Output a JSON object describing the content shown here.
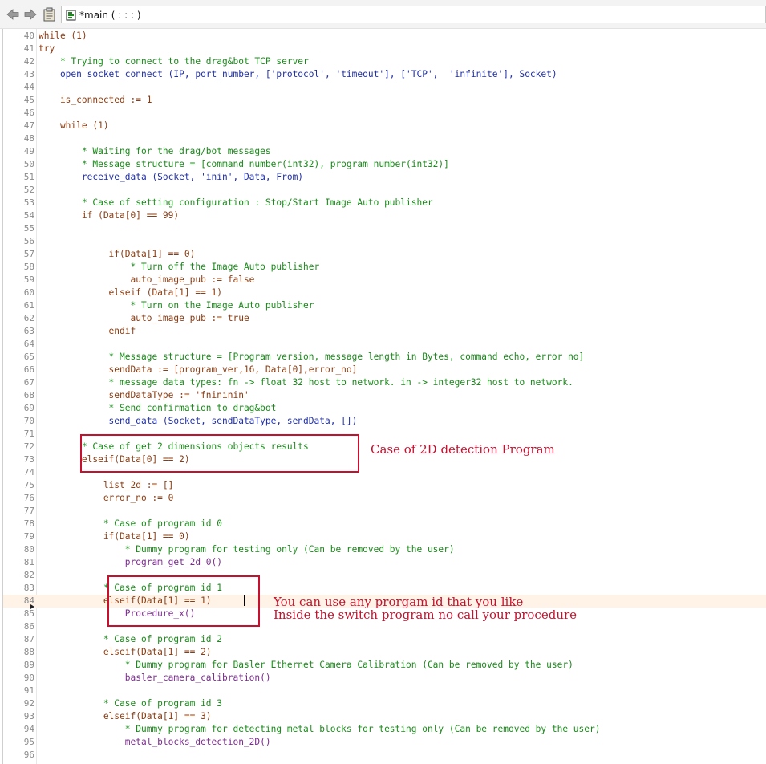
{
  "toolbar": {
    "back_icon": "left-arrow-icon",
    "forward_icon": "right-arrow-icon",
    "clipboard_icon": "clipboard-icon"
  },
  "tab": {
    "icon": "procedure-icon",
    "title": "*main ( : : : )"
  },
  "editor": {
    "current_line": 84,
    "lines": [
      {
        "n": "40",
        "t": "while (1)",
        "c": "kw"
      },
      {
        "n": "41",
        "t": "try",
        "c": "kw"
      },
      {
        "n": "42",
        "t": "    * Trying to connect to the drag&bot TCP server",
        "c": "cm"
      },
      {
        "n": "43",
        "t": "    open_socket_connect (IP, port_number, ['protocol', 'timeout'], ['TCP',  'infinite'], Socket)",
        "c": "fn"
      },
      {
        "n": "44",
        "t": "",
        "c": ""
      },
      {
        "n": "45",
        "t": "    is_connected := 1",
        "c": "kw"
      },
      {
        "n": "46",
        "t": "",
        "c": ""
      },
      {
        "n": "47",
        "t": "    while (1)",
        "c": "kw"
      },
      {
        "n": "48",
        "t": "",
        "c": ""
      },
      {
        "n": "49",
        "t": "        * Waiting for the drag/bot messages",
        "c": "cm"
      },
      {
        "n": "50",
        "t": "        * Message structure = [command number(int32), program number(int32)]",
        "c": "cm"
      },
      {
        "n": "51",
        "t": "        receive_data (Socket, 'inin', Data, From)",
        "c": "fn"
      },
      {
        "n": "52",
        "t": "",
        "c": ""
      },
      {
        "n": "53",
        "t": "        * Case of setting configuration : Stop/Start Image Auto publisher",
        "c": "cm"
      },
      {
        "n": "54",
        "t": "        if (Data[0] == 99)",
        "c": "kw"
      },
      {
        "n": "55",
        "t": "",
        "c": ""
      },
      {
        "n": "56",
        "t": "",
        "c": ""
      },
      {
        "n": "57",
        "t": "             if(Data[1] == 0)",
        "c": "kw"
      },
      {
        "n": "58",
        "t": "                 * Turn off the Image Auto publisher",
        "c": "cm"
      },
      {
        "n": "59",
        "t": "                 auto_image_pub := false",
        "c": "kw"
      },
      {
        "n": "60",
        "t": "             elseif (Data[1] == 1)",
        "c": "kw"
      },
      {
        "n": "61",
        "t": "                 * Turn on the Image Auto publisher",
        "c": "cm"
      },
      {
        "n": "62",
        "t": "                 auto_image_pub := true",
        "c": "kw"
      },
      {
        "n": "63",
        "t": "             endif",
        "c": "kw"
      },
      {
        "n": "64",
        "t": "",
        "c": ""
      },
      {
        "n": "65",
        "t": "             * Message structure = [Program version, message length in Bytes, command echo, error no]",
        "c": "cm"
      },
      {
        "n": "66",
        "t": "             sendData := [program_ver,16, Data[0],error_no]",
        "c": "kw"
      },
      {
        "n": "67",
        "t": "             * message data types: fn -> float 32 host to network. in -> integer32 host to network.",
        "c": "cm"
      },
      {
        "n": "68",
        "t": "             sendDataType := 'fnininin'",
        "c": "kw"
      },
      {
        "n": "69",
        "t": "             * Send confirmation to drag&bot",
        "c": "cm"
      },
      {
        "n": "70",
        "t": "             send_data (Socket, sendDataType, sendData, [])",
        "c": "fn"
      },
      {
        "n": "71",
        "t": "",
        "c": ""
      },
      {
        "n": "72",
        "t": "        * Case of get 2 dimensions objects results",
        "c": "cm"
      },
      {
        "n": "73",
        "t": "        elseif(Data[0] == 2)",
        "c": "kw"
      },
      {
        "n": "74",
        "t": "",
        "c": ""
      },
      {
        "n": "75",
        "t": "            list_2d := []",
        "c": "kw"
      },
      {
        "n": "76",
        "t": "            error_no := 0",
        "c": "kw"
      },
      {
        "n": "77",
        "t": "",
        "c": ""
      },
      {
        "n": "78",
        "t": "            * Case of program id 0",
        "c": "cm"
      },
      {
        "n": "79",
        "t": "            if(Data[1] == 0)",
        "c": "kw"
      },
      {
        "n": "80",
        "t": "                * Dummy program for testing only (Can be removed by the user)",
        "c": "cm"
      },
      {
        "n": "81",
        "t": "                program_get_2d_0()",
        "c": "pr"
      },
      {
        "n": "82",
        "t": "",
        "c": ""
      },
      {
        "n": "83",
        "t": "            * Case of program id 1",
        "c": "cm"
      },
      {
        "n": "84",
        "t": "            elseif(Data[1] == 1)",
        "c": "kw"
      },
      {
        "n": "85",
        "t": "                Procedure_x()",
        "c": "pr"
      },
      {
        "n": "86",
        "t": "",
        "c": ""
      },
      {
        "n": "87",
        "t": "            * Case of program id 2",
        "c": "cm"
      },
      {
        "n": "88",
        "t": "            elseif(Data[1] == 2)",
        "c": "kw"
      },
      {
        "n": "89",
        "t": "                * Dummy program for Basler Ethernet Camera Calibration (Can be removed by the user)",
        "c": "cm"
      },
      {
        "n": "90",
        "t": "                basler_camera_calibration()",
        "c": "pr"
      },
      {
        "n": "91",
        "t": "",
        "c": ""
      },
      {
        "n": "92",
        "t": "            * Case of program id 3",
        "c": "cm"
      },
      {
        "n": "93",
        "t": "            elseif(Data[1] == 3)",
        "c": "kw"
      },
      {
        "n": "94",
        "t": "                * Dummy program for detecting metal blocks for testing only (Can be removed by the user)",
        "c": "cm"
      },
      {
        "n": "95",
        "t": "                metal_blocks_detection_2D()",
        "c": "pr"
      },
      {
        "n": "96",
        "t": "",
        "c": ""
      }
    ]
  },
  "annotations": {
    "note_2d": "Case of 2D detection Program",
    "note_prog_1": "You can use any prorgam id that you like",
    "note_prog_2": "Inside the switch program no call your procedure"
  },
  "colors": {
    "keyword": "#8b3c12",
    "comment": "#1a8a1a",
    "builtin_call": "#1f2fa8",
    "procedure_call": "#7b2c8e",
    "annotation": "#c8102e",
    "current_line": "#fff2e6"
  }
}
